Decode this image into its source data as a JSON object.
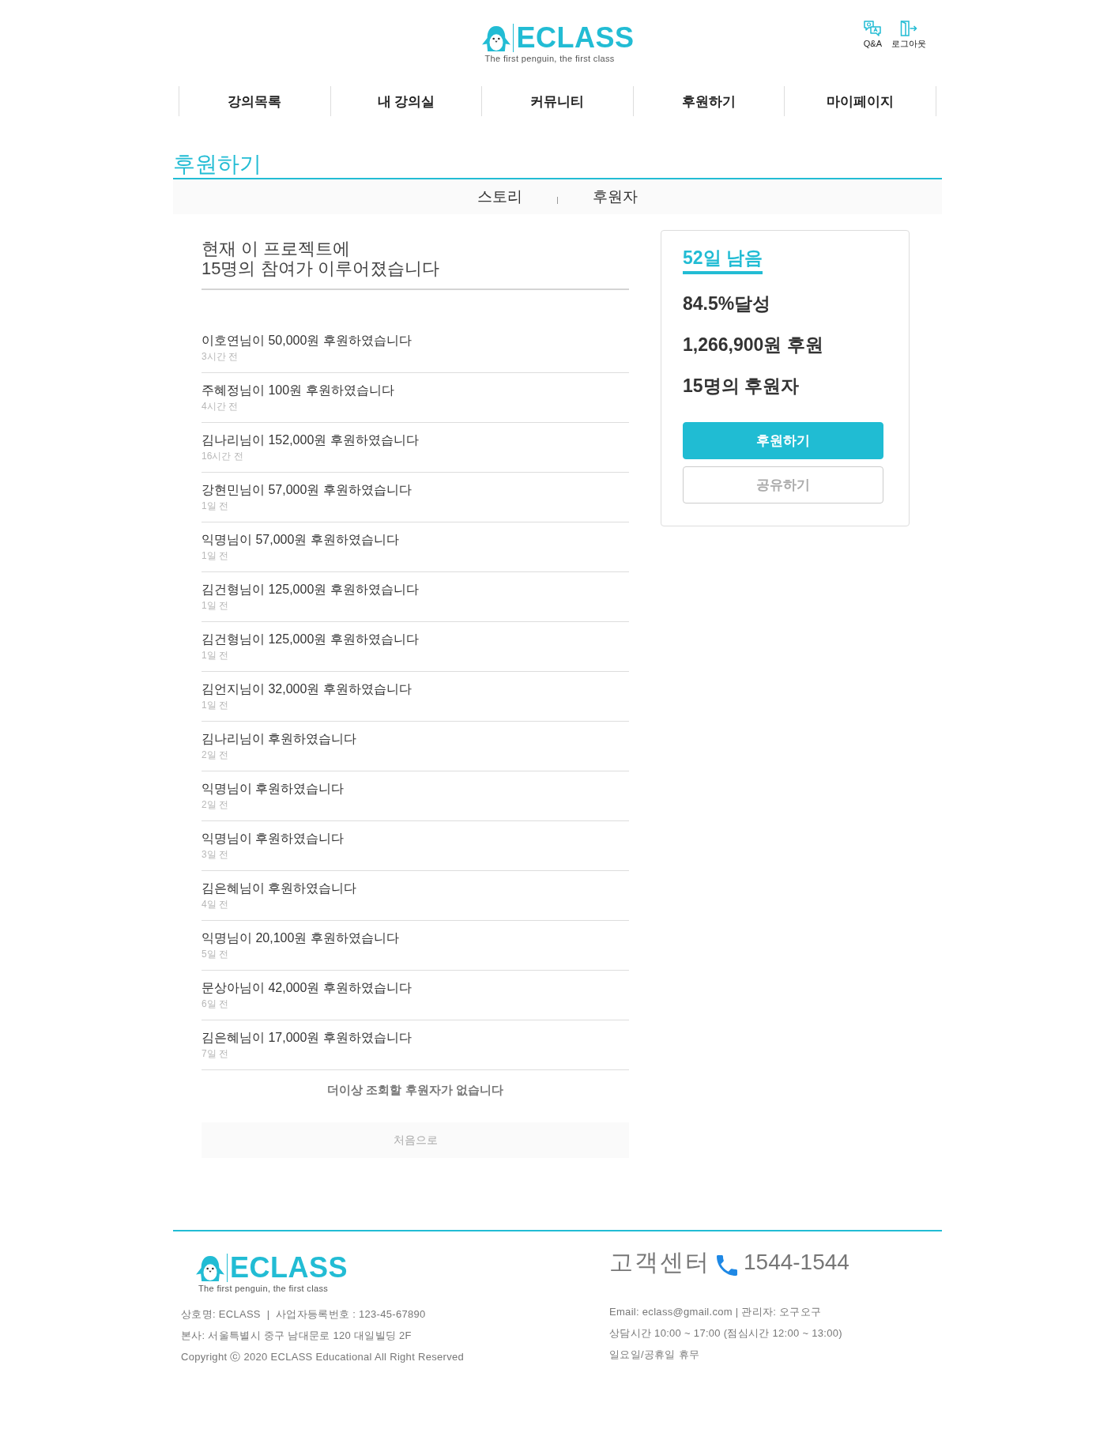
{
  "header": {
    "logo": {
      "wordmark": "ECLASS",
      "tagline": "The first penguin, the first class"
    },
    "utility_links": [
      {
        "label": "Q&A",
        "kind": "qa"
      },
      {
        "label": "로그아웃",
        "kind": "logout"
      }
    ]
  },
  "nav": {
    "items": [
      {
        "label": "강의목록"
      },
      {
        "label": "내 강의실"
      },
      {
        "label": "커뮤니티"
      },
      {
        "label": "후원하기"
      },
      {
        "label": "마이페이지"
      }
    ]
  },
  "page_title": "후원하기",
  "tabs": [
    {
      "label": "스토리"
    },
    {
      "label": "후원자"
    }
  ],
  "participation_summary": {
    "lines": [
      "현재 이 프로젝트에",
      "15명의 참여가 이루어졌습니다"
    ]
  },
  "donations": [
    {
      "message": "이호연님이 50,000원 후원하였습니다",
      "time": "3시간 전"
    },
    {
      "message": "주혜정님이 100원 후원하였습니다",
      "time": "4시간 전"
    },
    {
      "message": "김나리님이 152,000원 후원하였습니다",
      "time": "16시간 전"
    },
    {
      "message": "강현민님이 57,000원 후원하였습니다",
      "time": "1일 전"
    },
    {
      "message": "익명님이 57,000원 후원하였습니다",
      "time": "1일 전"
    },
    {
      "message": "김건형님이 125,000원 후원하였습니다",
      "time": "1일 전"
    },
    {
      "message": "김건형님이 125,000원 후원하였습니다",
      "time": "1일 전"
    },
    {
      "message": "김언지님이 32,000원 후원하였습니다",
      "time": "1일 전"
    },
    {
      "message": "김나리님이 후원하였습니다",
      "time": "2일 전"
    },
    {
      "message": "익명님이 후원하였습니다",
      "time": "2일 전"
    },
    {
      "message": "익명님이 후원하였습니다",
      "time": "3일 전"
    },
    {
      "message": "김은혜님이 후원하였습니다",
      "time": "4일 전"
    },
    {
      "message": "익명님이 20,100원 후원하였습니다",
      "time": "5일 전"
    },
    {
      "message": "문상아님이 42,000원 후원하였습니다",
      "time": "6일 전"
    },
    {
      "message": "김은혜님이 17,000원 후원하였습니다",
      "time": "7일 전"
    }
  ],
  "end_message": "더이상 조회할 후원자가 없습니다",
  "back_to_start_button": "처음으로",
  "funding_card": {
    "days_left": "52일 남음",
    "stats": [
      "84.5%달성",
      "1,266,900원 후원",
      "15명의 후원자"
    ],
    "buttons": [
      {
        "label": "후원하기",
        "kind": "primary"
      },
      {
        "label": "공유하기",
        "kind": "secondary"
      }
    ]
  },
  "footer": {
    "logo": {
      "wordmark": "ECLASS",
      "tagline": "The first penguin, the first class"
    },
    "company_lines": [
      "상호명: ECLASS  |  사업자등록번호 : 123-45-67890",
      "본사: 서울특별시 중구 남대문로 120 대일빌딩 2F",
      "Copyright ⓒ 2020 ECLASS Educational All Right Reserved"
    ],
    "customer_center": {
      "label": "고객센터",
      "phone": "1544-1544"
    },
    "info_lines": [
      "Email: eclass@gmail.com | 관리자: 오구오구",
      "상담시간 10:00 ~ 17:00 (점심시간 12:00 ~ 13:00)",
      "일요일/공휴일 휴무"
    ]
  }
}
